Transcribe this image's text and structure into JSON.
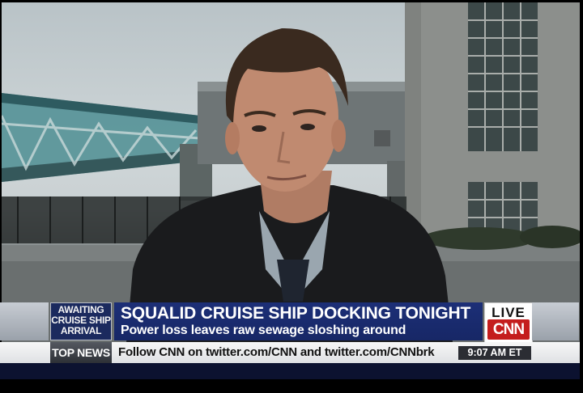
{
  "lower_third": {
    "tag_lines": [
      "AWAITING",
      "CRUISE SHIP",
      "ARRIVAL"
    ],
    "headline": "SQUALID CRUISE SHIP DOCKING TONIGHT",
    "subhead": "Power loss leaves raw sewage sloshing around"
  },
  "network": {
    "live_label": "LIVE",
    "logo_text": "CNN"
  },
  "ticker": {
    "label": "TOP NEWS",
    "text": "Follow CNN on twitter.com/CNN and twitter.com/CNNbrk"
  },
  "clock": {
    "time": "9:07 AM ET"
  },
  "colors": {
    "headline_blue": "#1c2f77",
    "cnn_red": "#c41d1d",
    "ticker_bg": "#efefef"
  }
}
